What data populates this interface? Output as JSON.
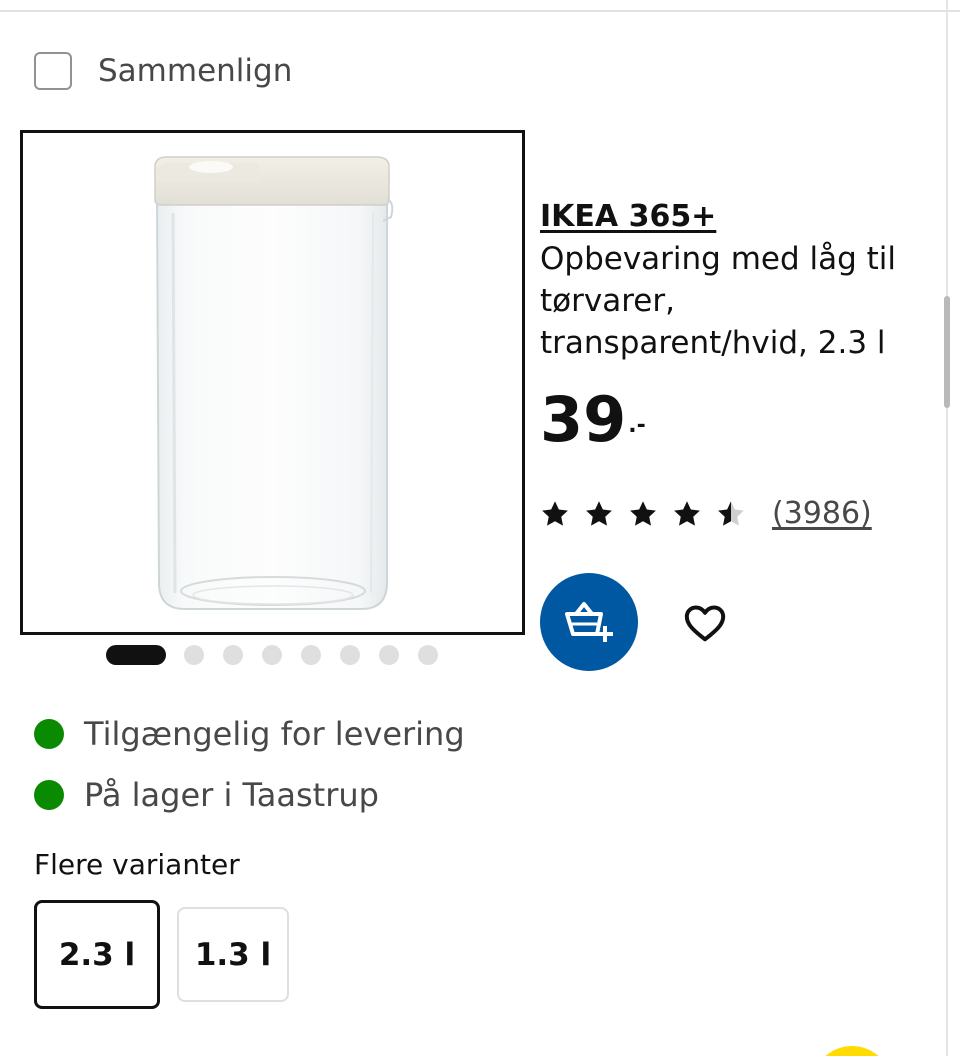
{
  "compare": {
    "label": "Sammenlign",
    "checked": false
  },
  "product": {
    "brand": "IKEA 365+",
    "description": "Opbevaring med låg til tørvarer, transparent/hvid, 2.3 l",
    "price": {
      "amount": "39",
      "suffix": ".-"
    },
    "rating": {
      "stars": 4.5,
      "max": 5,
      "count_label": "(3986)"
    }
  },
  "carousel": {
    "total": 8,
    "active_index": 0
  },
  "actions": {
    "add_to_cart_icon": "basket-plus-icon",
    "favorite_icon": "heart-icon"
  },
  "availability": [
    {
      "text": "Tilgængelig for levering",
      "color": "#0a8a00"
    },
    {
      "text": "På lager i Taastrup",
      "color": "#0a8a00"
    }
  ],
  "variants": {
    "title": "Flere varianter",
    "options": [
      {
        "label": "2.3 l",
        "selected": true
      },
      {
        "label": "1.3 l",
        "selected": false
      }
    ]
  },
  "colors": {
    "accent": "#0058a3",
    "stock": "#0a8a00",
    "text": "#111111"
  }
}
